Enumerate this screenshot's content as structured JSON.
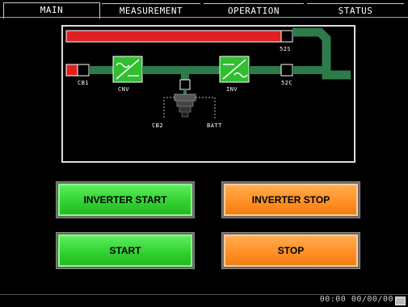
{
  "tabs": [
    {
      "label": "MAIN",
      "active": true
    },
    {
      "label": "MEASUREMENT",
      "active": false
    },
    {
      "label": "OPERATION",
      "active": false
    },
    {
      "label": "STATUS",
      "active": false
    }
  ],
  "diagram": {
    "labels": {
      "s2s": "52S",
      "s2c": "52C",
      "cb1": "CB1",
      "cnv": "CNV",
      "inv": "INV",
      "cb2": "CB2",
      "batt": "BATT"
    },
    "colors": {
      "live": "#e02020",
      "path": "#2f7a4a",
      "converter": "#2fbf2f"
    }
  },
  "buttons": {
    "inverter_start": "INVERTER START",
    "inverter_stop": "INVERTER STOP",
    "start": "START",
    "stop": "STOP"
  },
  "status": {
    "clock": "00:00  00/00/00"
  }
}
